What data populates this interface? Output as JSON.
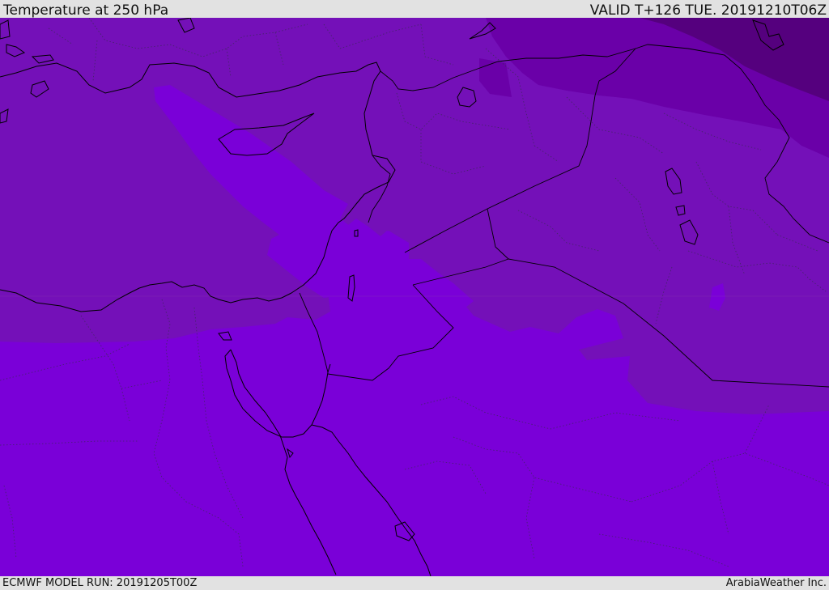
{
  "header": {
    "title": "Temperature at 250 hPa",
    "valid": "VALID T+126 TUE. 20191210T06Z"
  },
  "footer": {
    "model_run": "ECMWF MODEL RUN: 20191205T00Z",
    "credit": "ArabiaWeather Inc."
  },
  "colors": {
    "warmest_band": "#7a00d8",
    "mid_band": "#7410b8",
    "cool_band": "#6a00a8",
    "coldest_band": "#55007e",
    "lines": "#000000"
  }
}
